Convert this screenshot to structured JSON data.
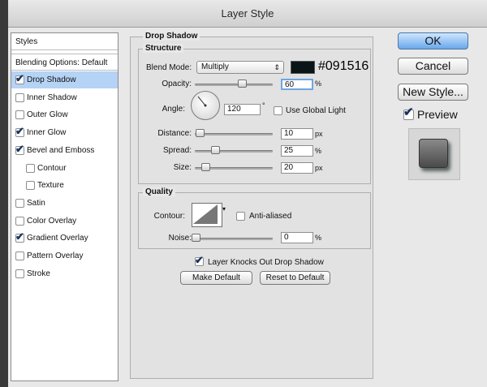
{
  "window": {
    "title": "Layer Style"
  },
  "sidebar": {
    "styles_header": "Styles",
    "blending_header": "Blending Options: Default",
    "items": [
      {
        "label": "Drop Shadow",
        "checked": true,
        "selected": true,
        "indent": false
      },
      {
        "label": "Inner Shadow",
        "checked": false,
        "selected": false,
        "indent": false
      },
      {
        "label": "Outer Glow",
        "checked": false,
        "selected": false,
        "indent": false
      },
      {
        "label": "Inner Glow",
        "checked": true,
        "selected": false,
        "indent": false
      },
      {
        "label": "Bevel and Emboss",
        "checked": true,
        "selected": false,
        "indent": false
      },
      {
        "label": "Contour",
        "checked": false,
        "selected": false,
        "indent": true
      },
      {
        "label": "Texture",
        "checked": false,
        "selected": false,
        "indent": true
      },
      {
        "label": "Satin",
        "checked": false,
        "selected": false,
        "indent": false
      },
      {
        "label": "Color Overlay",
        "checked": false,
        "selected": false,
        "indent": false
      },
      {
        "label": "Gradient Overlay",
        "checked": true,
        "selected": false,
        "indent": false
      },
      {
        "label": "Pattern Overlay",
        "checked": false,
        "selected": false,
        "indent": false
      },
      {
        "label": "Stroke",
        "checked": false,
        "selected": false,
        "indent": false
      }
    ]
  },
  "drop_shadow": {
    "title": "Drop Shadow",
    "structure": {
      "title": "Structure",
      "blend_mode_label": "Blend Mode:",
      "blend_mode_value": "Multiply",
      "color": "#091516",
      "color_label": "#091516",
      "opacity_label": "Opacity:",
      "opacity_value": "60",
      "opacity_unit": "%",
      "opacity_fraction": 0.6,
      "angle_label": "Angle:",
      "angle_value": "120",
      "angle_unit": "°",
      "use_global_light_label": "Use Global Light",
      "use_global_light_checked": false,
      "distance_label": "Distance:",
      "distance_value": "10",
      "distance_unit": "px",
      "spread_label": "Spread:",
      "spread_value": "25",
      "spread_unit": "%",
      "size_label": "Size:",
      "size_value": "20",
      "size_unit": "px"
    },
    "quality": {
      "title": "Quality",
      "contour_label": "Contour:",
      "anti_aliased_label": "Anti-aliased",
      "anti_aliased_checked": false,
      "noise_label": "Noise:",
      "noise_value": "0",
      "noise_unit": "%"
    },
    "knockout_label": "Layer Knocks Out Drop Shadow",
    "knockout_checked": true,
    "make_default_label": "Make Default",
    "reset_default_label": "Reset to Default"
  },
  "buttons": {
    "ok_label": "OK",
    "cancel_label": "Cancel",
    "new_style_label": "New Style...",
    "preview_label": "Preview",
    "preview_checked": true
  },
  "colors": {
    "accent": "#69a8ea",
    "selection": "#b5d3f5",
    "shadow_color": "#091516"
  }
}
